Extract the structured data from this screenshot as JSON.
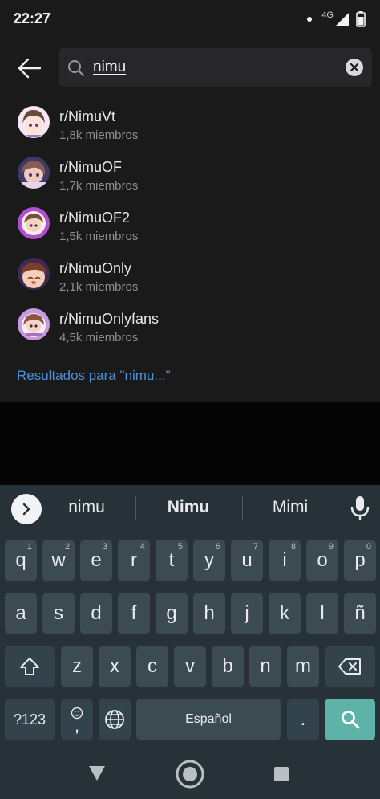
{
  "status_bar": {
    "time": "22:27",
    "network": "4G",
    "icons": [
      "notification-dot",
      "signal-icon",
      "battery-icon"
    ]
  },
  "search": {
    "query": "nimu",
    "back_icon": "arrow-left-icon",
    "search_icon": "magnifier-icon",
    "clear_icon": "clear-x-icon"
  },
  "results": [
    {
      "name": "r/NimuVt",
      "members": "1,8k miembros"
    },
    {
      "name": "r/NimuOF",
      "members": "1,7k miembros"
    },
    {
      "name": "r/NimuOF2",
      "members": "1,5k miembros"
    },
    {
      "name": "r/NimuOnly",
      "members": "2,1k miembros"
    },
    {
      "name": "r/NimuOnlyfans",
      "members": "4,5k miembros"
    }
  ],
  "see_all": "Resultados para \"nimu...\"",
  "keyboard": {
    "suggestions": [
      "nimu",
      "Nimu",
      "Mimi"
    ],
    "row1": [
      {
        "k": "q",
        "h": "1"
      },
      {
        "k": "w",
        "h": "2"
      },
      {
        "k": "e",
        "h": "3"
      },
      {
        "k": "r",
        "h": "4"
      },
      {
        "k": "t",
        "h": "5"
      },
      {
        "k": "y",
        "h": "6"
      },
      {
        "k": "u",
        "h": "7"
      },
      {
        "k": "i",
        "h": "8"
      },
      {
        "k": "o",
        "h": "9"
      },
      {
        "k": "p",
        "h": "0"
      }
    ],
    "row2": [
      "a",
      "s",
      "d",
      "f",
      "g",
      "h",
      "j",
      "k",
      "l",
      "ñ"
    ],
    "row3": [
      "z",
      "x",
      "c",
      "v",
      "b",
      "n",
      "m"
    ],
    "symbols_label": "?123",
    "comma_label": ",",
    "space_label": "Español",
    "period_label": ".",
    "icons": [
      "expand-chevron-icon",
      "mic-icon",
      "shift-icon",
      "backspace-icon",
      "emoji-icon",
      "globe-icon",
      "search-icon"
    ]
  },
  "nav_bar": {
    "icons": [
      "back-triangle-icon",
      "home-circle-icon",
      "recents-square-icon"
    ]
  },
  "colors": {
    "panel": "#1a1a1b",
    "link": "#4a8fd9",
    "keyboard": "#263238",
    "key": "#3c4a51",
    "action_key": "#5eb3a8"
  }
}
